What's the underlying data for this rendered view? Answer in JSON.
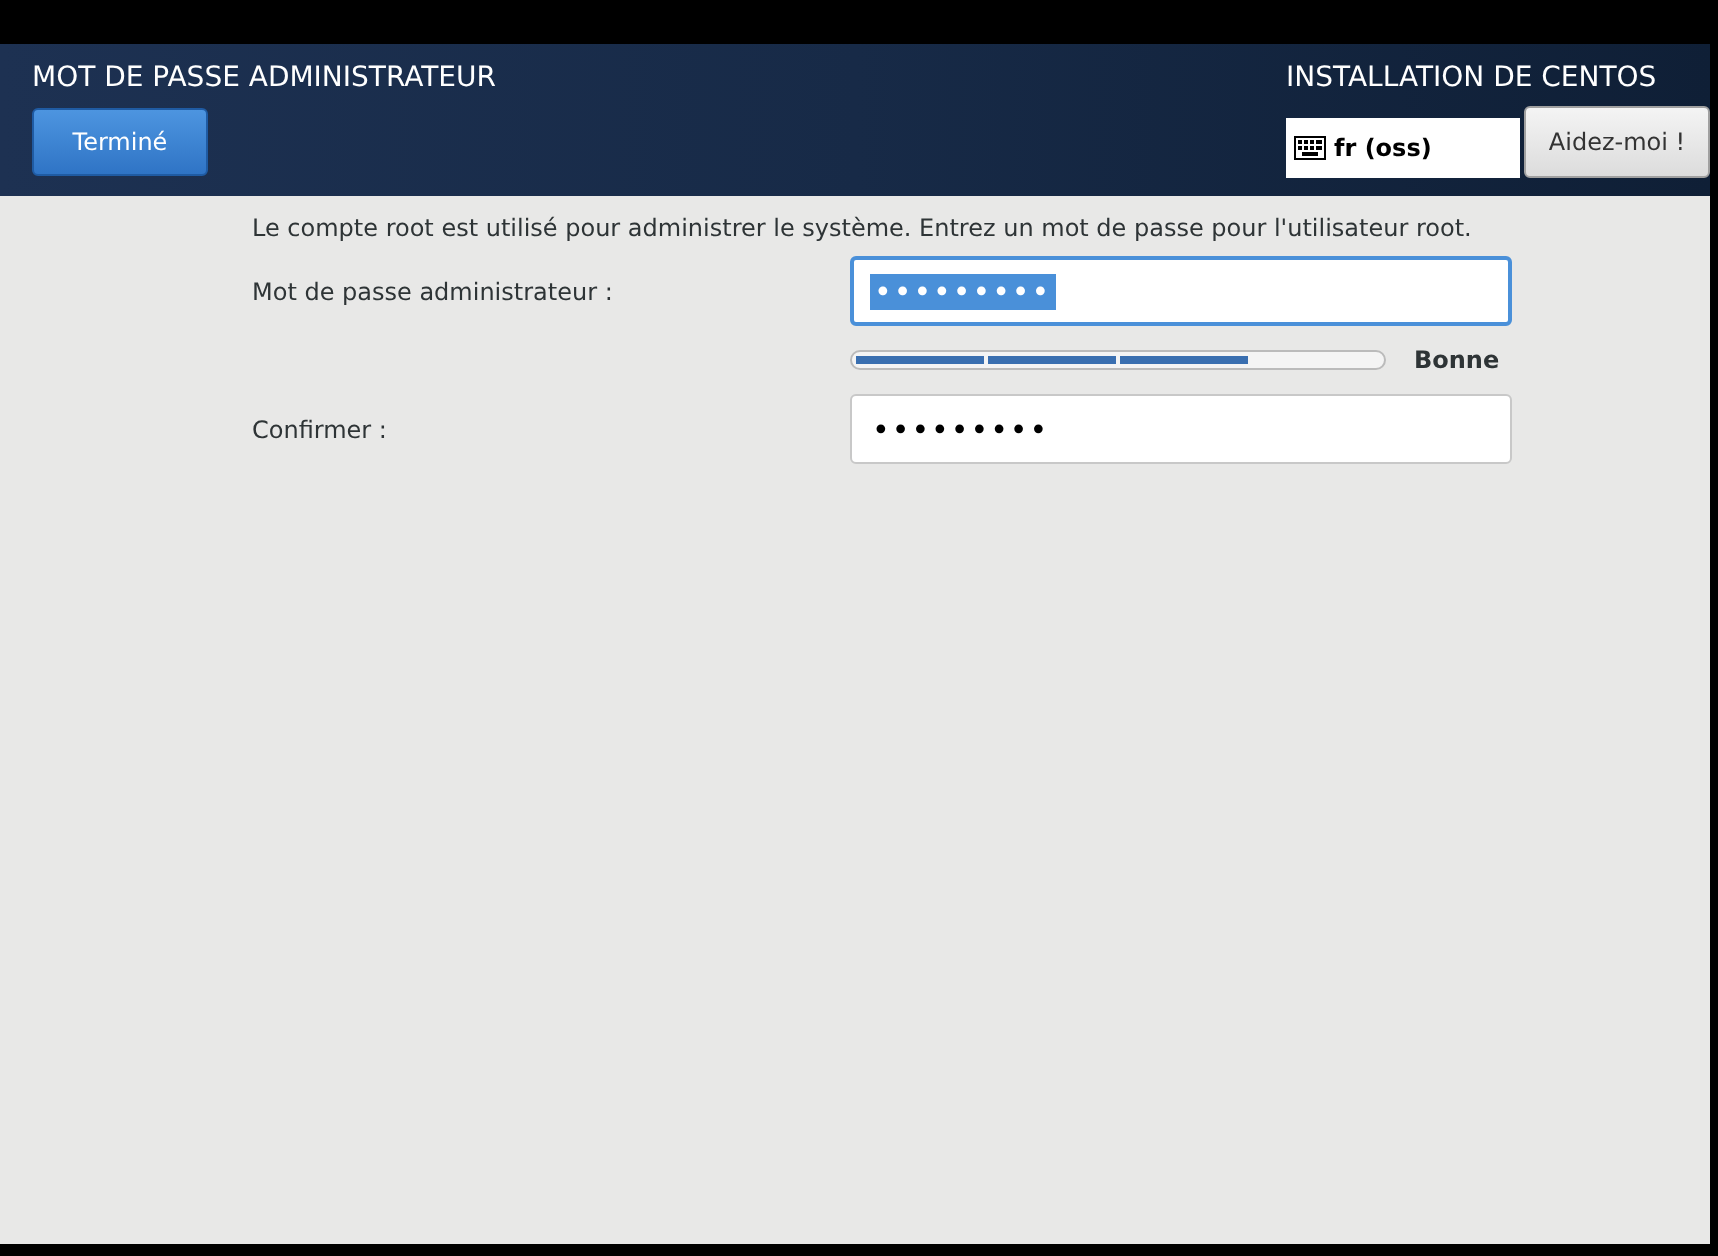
{
  "header": {
    "title": "MOT DE PASSE ADMINISTRATEUR",
    "done_button": "Terminé",
    "product": "INSTALLATION DE CENTOS",
    "keyboard": "fr (oss)",
    "help_button": "Aidez-moi !"
  },
  "intro": "Le compte root est utilisé pour administrer le système. Entrez un mot de passe pour l'utilisateur root.",
  "fields": [
    {
      "label": "Mot de passe administrateur :",
      "value": "•••••••••",
      "focused": true
    },
    {
      "label": "Confirmer :",
      "value": "•••••••••",
      "focused": false
    }
  ],
  "strength": {
    "level": 0.75,
    "label": "Bonne"
  }
}
